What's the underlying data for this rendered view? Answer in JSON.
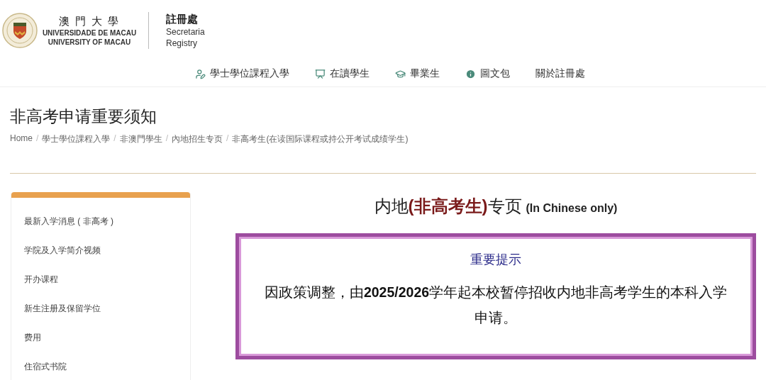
{
  "header": {
    "university_chinese": "澳 門 大 學",
    "university_portuguese": "UNIVERSIDADE DE MACAU",
    "university_english": "UNIVERSITY OF MACAU",
    "office_chinese": "註冊處",
    "office_portuguese": "Secretaria",
    "office_english": "Registry"
  },
  "nav": [
    {
      "label": "學士學位課程入學"
    },
    {
      "label": "在讀學生"
    },
    {
      "label": "畢業生"
    },
    {
      "label": "圖文包"
    },
    {
      "label": "關於註冊處"
    }
  ],
  "page_title": "非高考申请重要须知",
  "breadcrumb_separator": "/",
  "breadcrumb": [
    "Home",
    "學士學位課程入學",
    "非澳門學生",
    "內地招生专页",
    "非高考生(在读国际课程或持公开考试成绩学生)"
  ],
  "sidebar": {
    "items": [
      {
        "label": "最新入学消息 ( 非高考 )"
      },
      {
        "label": "学院及入学简介视频"
      },
      {
        "label": "开办课程"
      },
      {
        "label": "新生注册及保留学位"
      },
      {
        "label": "费用"
      },
      {
        "label": "住宿式书院"
      }
    ]
  },
  "heading": {
    "parts": [
      {
        "text": "内地",
        "kind": "plain"
      },
      {
        "text": "(非高考生)",
        "kind": "highlight"
      },
      {
        "text": "专页",
        "kind": "plain"
      }
    ],
    "note": "(In Chinese only)"
  },
  "notice": {
    "title": "重要提示",
    "body": "因政策调整，由**2025/2026**学年起本校暂停招收内地非高考学生的本科入学申请。"
  }
}
